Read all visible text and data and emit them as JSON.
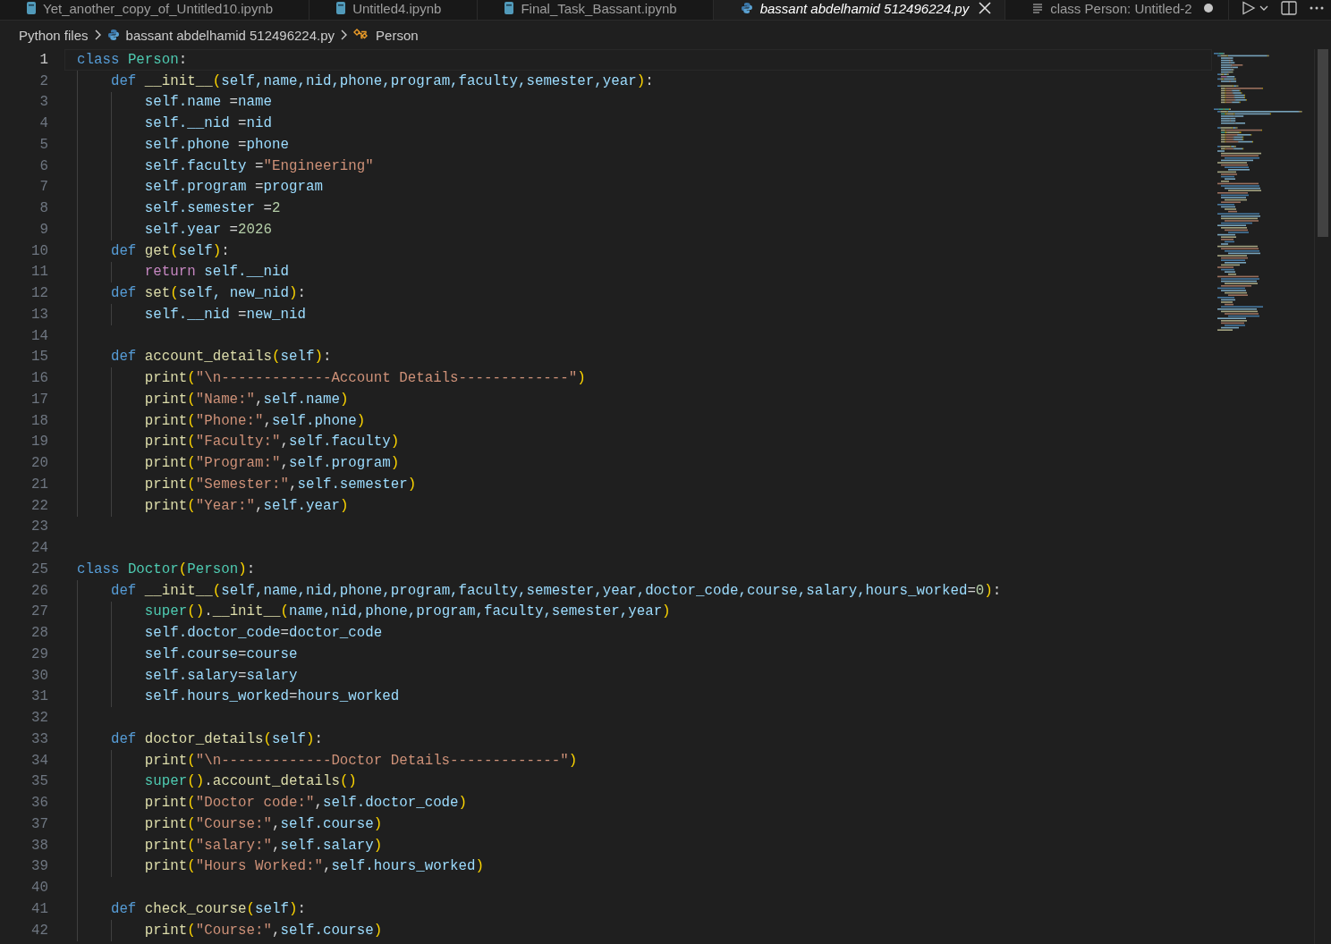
{
  "tabs": [
    {
      "label": "Yet_another_copy_of_Untitled10.ipynb",
      "kind": "notebook",
      "selected": false,
      "preview": false,
      "dirty": false
    },
    {
      "label": "Untitled4.ipynb",
      "kind": "notebook",
      "selected": false,
      "preview": false,
      "dirty": false
    },
    {
      "label": "Final_Task_Bassant.ipynb",
      "kind": "notebook",
      "selected": false,
      "preview": false,
      "dirty": false
    },
    {
      "label": "bassant abdelhamid 512496224.py",
      "kind": "python",
      "selected": true,
      "preview": true,
      "dirty": false
    },
    {
      "label": "class Person: Untitled-2",
      "kind": "text",
      "selected": false,
      "preview": false,
      "dirty": true
    }
  ],
  "breadcrumb": [
    {
      "label": "Python files",
      "kind": "folder"
    },
    {
      "label": "bassant abdelhamid 512496224.py",
      "kind": "python"
    },
    {
      "label": "Person",
      "kind": "class"
    }
  ],
  "editor": {
    "lines": [
      {
        "number": "1",
        "current": true,
        "tokens": [
          {
            "kind": "kw",
            "text": "class "
          },
          {
            "kind": "cls",
            "text": "Person"
          },
          {
            "kind": "op",
            "text": ":"
          }
        ],
        "children": [
          {
            "number": "2",
            "current": false,
            "tokens": [
              {
                "kind": "kw",
                "text": "def "
              },
              {
                "kind": "fn",
                "text": "__init__"
              },
              {
                "kind": "b1",
                "text": "("
              },
              {
                "kind": "var",
                "text": "self,name,nid,phone,program,faculty,semester,year"
              },
              {
                "kind": "b1",
                "text": ")"
              },
              {
                "kind": "op",
                "text": ":"
              }
            ],
            "children": [
              {
                "number": "3",
                "current": false,
                "tokens": [
                  {
                    "kind": "var",
                    "text": "self.name"
                  },
                  {
                    "kind": "op",
                    "text": " ="
                  },
                  {
                    "kind": "var",
                    "text": "name"
                  }
                ]
              },
              {
                "number": "4",
                "current": false,
                "tokens": [
                  {
                    "kind": "var",
                    "text": "self.__nid"
                  },
                  {
                    "kind": "op",
                    "text": " ="
                  },
                  {
                    "kind": "var",
                    "text": "nid"
                  }
                ]
              },
              {
                "number": "5",
                "current": false,
                "tokens": [
                  {
                    "kind": "var",
                    "text": "self.phone"
                  },
                  {
                    "kind": "op",
                    "text": " ="
                  },
                  {
                    "kind": "var",
                    "text": "phone"
                  }
                ]
              },
              {
                "number": "6",
                "current": false,
                "tokens": [
                  {
                    "kind": "var",
                    "text": "self.faculty"
                  },
                  {
                    "kind": "op",
                    "text": " ="
                  },
                  {
                    "kind": "str",
                    "text": "\"Engineering\""
                  }
                ]
              },
              {
                "number": "7",
                "current": false,
                "tokens": [
                  {
                    "kind": "var",
                    "text": "self.program"
                  },
                  {
                    "kind": "op",
                    "text": " ="
                  },
                  {
                    "kind": "var",
                    "text": "program"
                  }
                ]
              },
              {
                "number": "8",
                "current": false,
                "tokens": [
                  {
                    "kind": "var",
                    "text": "self.semester"
                  },
                  {
                    "kind": "op",
                    "text": " ="
                  },
                  {
                    "kind": "num",
                    "text": "2"
                  }
                ]
              },
              {
                "number": "9",
                "current": false,
                "tokens": [
                  {
                    "kind": "var",
                    "text": "self.year"
                  },
                  {
                    "kind": "op",
                    "text": " ="
                  },
                  {
                    "kind": "num",
                    "text": "2026"
                  }
                ]
              }
            ]
          },
          {
            "number": "10",
            "current": false,
            "tokens": [
              {
                "kind": "kw",
                "text": "def "
              },
              {
                "kind": "fn",
                "text": "get"
              },
              {
                "kind": "b1",
                "text": "("
              },
              {
                "kind": "var",
                "text": "self"
              },
              {
                "kind": "b1",
                "text": ")"
              },
              {
                "kind": "op",
                "text": ":"
              }
            ],
            "children": [
              {
                "number": "11",
                "current": false,
                "tokens": [
                  {
                    "kind": "ctl",
                    "text": "return "
                  },
                  {
                    "kind": "var",
                    "text": "self.__nid"
                  }
                ]
              }
            ]
          },
          {
            "number": "12",
            "current": false,
            "tokens": [
              {
                "kind": "kw",
                "text": "def "
              },
              {
                "kind": "fn",
                "text": "set"
              },
              {
                "kind": "b1",
                "text": "("
              },
              {
                "kind": "var",
                "text": "self, new_nid"
              },
              {
                "kind": "b1",
                "text": ")"
              },
              {
                "kind": "op",
                "text": ":"
              }
            ],
            "children": [
              {
                "number": "13",
                "current": false,
                "tokens": [
                  {
                    "kind": "var",
                    "text": "self.__nid"
                  },
                  {
                    "kind": "op",
                    "text": " ="
                  },
                  {
                    "kind": "var",
                    "text": "new_nid"
                  }
                ]
              }
            ]
          },
          {
            "number": "14",
            "current": false
          },
          {
            "number": "15",
            "current": false,
            "tokens": [
              {
                "kind": "kw",
                "text": "def "
              },
              {
                "kind": "fn",
                "text": "account_details"
              },
              {
                "kind": "b1",
                "text": "("
              },
              {
                "kind": "var",
                "text": "self"
              },
              {
                "kind": "b1",
                "text": ")"
              },
              {
                "kind": "op",
                "text": ":"
              }
            ],
            "children": [
              {
                "number": "16",
                "current": false,
                "tokens": [
                  {
                    "kind": "fn",
                    "text": "print"
                  },
                  {
                    "kind": "b1",
                    "text": "("
                  },
                  {
                    "kind": "str",
                    "text": "\"\\n-------------Account Details-------------\""
                  },
                  {
                    "kind": "b1",
                    "text": ")"
                  }
                ]
              },
              {
                "number": "17",
                "current": false,
                "tokens": [
                  {
                    "kind": "fn",
                    "text": "print"
                  },
                  {
                    "kind": "b1",
                    "text": "("
                  },
                  {
                    "kind": "str",
                    "text": "\"Name:\""
                  },
                  {
                    "kind": "op",
                    "text": ","
                  },
                  {
                    "kind": "var",
                    "text": "self.name"
                  },
                  {
                    "kind": "b1",
                    "text": ")"
                  }
                ]
              },
              {
                "number": "18",
                "current": false,
                "tokens": [
                  {
                    "kind": "fn",
                    "text": "print"
                  },
                  {
                    "kind": "b1",
                    "text": "("
                  },
                  {
                    "kind": "str",
                    "text": "\"Phone:\""
                  },
                  {
                    "kind": "op",
                    "text": ","
                  },
                  {
                    "kind": "var",
                    "text": "self.phone"
                  },
                  {
                    "kind": "b1",
                    "text": ")"
                  }
                ]
              },
              {
                "number": "19",
                "current": false,
                "tokens": [
                  {
                    "kind": "fn",
                    "text": "print"
                  },
                  {
                    "kind": "b1",
                    "text": "("
                  },
                  {
                    "kind": "str",
                    "text": "\"Faculty:\""
                  },
                  {
                    "kind": "op",
                    "text": ","
                  },
                  {
                    "kind": "var",
                    "text": "self.faculty"
                  },
                  {
                    "kind": "b1",
                    "text": ")"
                  }
                ]
              },
              {
                "number": "20",
                "current": false,
                "tokens": [
                  {
                    "kind": "fn",
                    "text": "print"
                  },
                  {
                    "kind": "b1",
                    "text": "("
                  },
                  {
                    "kind": "str",
                    "text": "\"Program:\""
                  },
                  {
                    "kind": "op",
                    "text": ","
                  },
                  {
                    "kind": "var",
                    "text": "self.program"
                  },
                  {
                    "kind": "b1",
                    "text": ")"
                  }
                ]
              },
              {
                "number": "21",
                "current": false,
                "tokens": [
                  {
                    "kind": "fn",
                    "text": "print"
                  },
                  {
                    "kind": "b1",
                    "text": "("
                  },
                  {
                    "kind": "str",
                    "text": "\"Semester:\""
                  },
                  {
                    "kind": "op",
                    "text": ","
                  },
                  {
                    "kind": "var",
                    "text": "self.semester"
                  },
                  {
                    "kind": "b1",
                    "text": ")"
                  }
                ]
              },
              {
                "number": "22",
                "current": false,
                "tokens": [
                  {
                    "kind": "fn",
                    "text": "print"
                  },
                  {
                    "kind": "b1",
                    "text": "("
                  },
                  {
                    "kind": "str",
                    "text": "\"Year:\""
                  },
                  {
                    "kind": "op",
                    "text": ","
                  },
                  {
                    "kind": "var",
                    "text": "self.year"
                  },
                  {
                    "kind": "b1",
                    "text": ")"
                  }
                ]
              }
            ]
          }
        ]
      },
      {
        "number": "23",
        "current": false
      },
      {
        "number": "24",
        "current": false
      },
      {
        "number": "25",
        "current": false,
        "tokens": [
          {
            "kind": "kw",
            "text": "class "
          },
          {
            "kind": "cls",
            "text": "Doctor"
          },
          {
            "kind": "b1",
            "text": "("
          },
          {
            "kind": "cls",
            "text": "Person"
          },
          {
            "kind": "b1",
            "text": ")"
          },
          {
            "kind": "op",
            "text": ":"
          }
        ],
        "children": [
          {
            "number": "26",
            "current": false,
            "tokens": [
              {
                "kind": "kw",
                "text": "def "
              },
              {
                "kind": "fn",
                "text": "__init__"
              },
              {
                "kind": "b1",
                "text": "("
              },
              {
                "kind": "var",
                "text": "self,name,nid,phone,program,faculty,semester,year,doctor_code,course,salary,hours_worked"
              },
              {
                "kind": "op",
                "text": "="
              },
              {
                "kind": "num",
                "text": "0"
              },
              {
                "kind": "b1",
                "text": ")"
              },
              {
                "kind": "op",
                "text": ":"
              }
            ],
            "children": [
              {
                "number": "27",
                "current": false,
                "tokens": [
                  {
                    "kind": "cls",
                    "text": "super"
                  },
                  {
                    "kind": "b1",
                    "text": "()"
                  },
                  {
                    "kind": "op",
                    "text": "."
                  },
                  {
                    "kind": "fn",
                    "text": "__init__"
                  },
                  {
                    "kind": "b1",
                    "text": "("
                  },
                  {
                    "kind": "var",
                    "text": "name,nid,phone,program,faculty,semester,year"
                  },
                  {
                    "kind": "b1",
                    "text": ")"
                  }
                ]
              },
              {
                "number": "28",
                "current": false,
                "tokens": [
                  {
                    "kind": "var",
                    "text": "self.doctor_code"
                  },
                  {
                    "kind": "op",
                    "text": "="
                  },
                  {
                    "kind": "var",
                    "text": "doctor_code"
                  }
                ]
              },
              {
                "number": "29",
                "current": false,
                "tokens": [
                  {
                    "kind": "var",
                    "text": "self.course"
                  },
                  {
                    "kind": "op",
                    "text": "="
                  },
                  {
                    "kind": "var",
                    "text": "course"
                  }
                ]
              },
              {
                "number": "30",
                "current": false,
                "tokens": [
                  {
                    "kind": "var",
                    "text": "self.salary"
                  },
                  {
                    "kind": "op",
                    "text": "="
                  },
                  {
                    "kind": "var",
                    "text": "salary"
                  }
                ]
              },
              {
                "number": "31",
                "current": false,
                "tokens": [
                  {
                    "kind": "var",
                    "text": "self.hours_worked"
                  },
                  {
                    "kind": "op",
                    "text": "="
                  },
                  {
                    "kind": "var",
                    "text": "hours_worked"
                  }
                ]
              }
            ]
          },
          {
            "number": "32",
            "current": false
          },
          {
            "number": "33",
            "current": false,
            "tokens": [
              {
                "kind": "kw",
                "text": "def "
              },
              {
                "kind": "fn",
                "text": "doctor_details"
              },
              {
                "kind": "b1",
                "text": "("
              },
              {
                "kind": "var",
                "text": "self"
              },
              {
                "kind": "b1",
                "text": ")"
              },
              {
                "kind": "op",
                "text": ":"
              }
            ],
            "children": [
              {
                "number": "34",
                "current": false,
                "tokens": [
                  {
                    "kind": "fn",
                    "text": "print"
                  },
                  {
                    "kind": "b1",
                    "text": "("
                  },
                  {
                    "kind": "str",
                    "text": "\"\\n-------------Doctor Details-------------\""
                  },
                  {
                    "kind": "b1",
                    "text": ")"
                  }
                ]
              },
              {
                "number": "35",
                "current": false,
                "tokens": [
                  {
                    "kind": "cls",
                    "text": "super"
                  },
                  {
                    "kind": "b1",
                    "text": "()"
                  },
                  {
                    "kind": "op",
                    "text": "."
                  },
                  {
                    "kind": "fn",
                    "text": "account_details"
                  },
                  {
                    "kind": "b1",
                    "text": "()"
                  }
                ]
              },
              {
                "number": "36",
                "current": false,
                "tokens": [
                  {
                    "kind": "fn",
                    "text": "print"
                  },
                  {
                    "kind": "b1",
                    "text": "("
                  },
                  {
                    "kind": "str",
                    "text": "\"Doctor code:\""
                  },
                  {
                    "kind": "op",
                    "text": ","
                  },
                  {
                    "kind": "var",
                    "text": "self.doctor_code"
                  },
                  {
                    "kind": "b1",
                    "text": ")"
                  }
                ]
              },
              {
                "number": "37",
                "current": false,
                "tokens": [
                  {
                    "kind": "fn",
                    "text": "print"
                  },
                  {
                    "kind": "b1",
                    "text": "("
                  },
                  {
                    "kind": "str",
                    "text": "\"Course:\""
                  },
                  {
                    "kind": "op",
                    "text": ","
                  },
                  {
                    "kind": "var",
                    "text": "self.course"
                  },
                  {
                    "kind": "b1",
                    "text": ")"
                  }
                ]
              },
              {
                "number": "38",
                "current": false,
                "tokens": [
                  {
                    "kind": "fn",
                    "text": "print"
                  },
                  {
                    "kind": "b1",
                    "text": "("
                  },
                  {
                    "kind": "str",
                    "text": "\"salary:\""
                  },
                  {
                    "kind": "op",
                    "text": ","
                  },
                  {
                    "kind": "var",
                    "text": "self.salary"
                  },
                  {
                    "kind": "b1",
                    "text": ")"
                  }
                ]
              },
              {
                "number": "39",
                "current": false,
                "tokens": [
                  {
                    "kind": "fn",
                    "text": "print"
                  },
                  {
                    "kind": "b1",
                    "text": "("
                  },
                  {
                    "kind": "str",
                    "text": "\"Hours Worked:\""
                  },
                  {
                    "kind": "op",
                    "text": ","
                  },
                  {
                    "kind": "var",
                    "text": "self.hours_worked"
                  },
                  {
                    "kind": "b1",
                    "text": ")"
                  }
                ]
              }
            ]
          },
          {
            "number": "40",
            "current": false
          },
          {
            "number": "41",
            "current": false,
            "tokens": [
              {
                "kind": "kw",
                "text": "def "
              },
              {
                "kind": "fn",
                "text": "check_course"
              },
              {
                "kind": "b1",
                "text": "("
              },
              {
                "kind": "var",
                "text": "self"
              },
              {
                "kind": "b1",
                "text": ")"
              },
              {
                "kind": "op",
                "text": ":"
              }
            ],
            "children": [
              {
                "number": "42",
                "current": false,
                "tokens": [
                  {
                    "kind": "fn",
                    "text": "print"
                  },
                  {
                    "kind": "b1",
                    "text": "("
                  },
                  {
                    "kind": "str",
                    "text": "\"Course:\""
                  },
                  {
                    "kind": "op",
                    "text": ","
                  },
                  {
                    "kind": "var",
                    "text": "self.course"
                  },
                  {
                    "kind": "b1",
                    "text": ")"
                  }
                ]
              }
            ]
          }
        ]
      }
    ]
  }
}
